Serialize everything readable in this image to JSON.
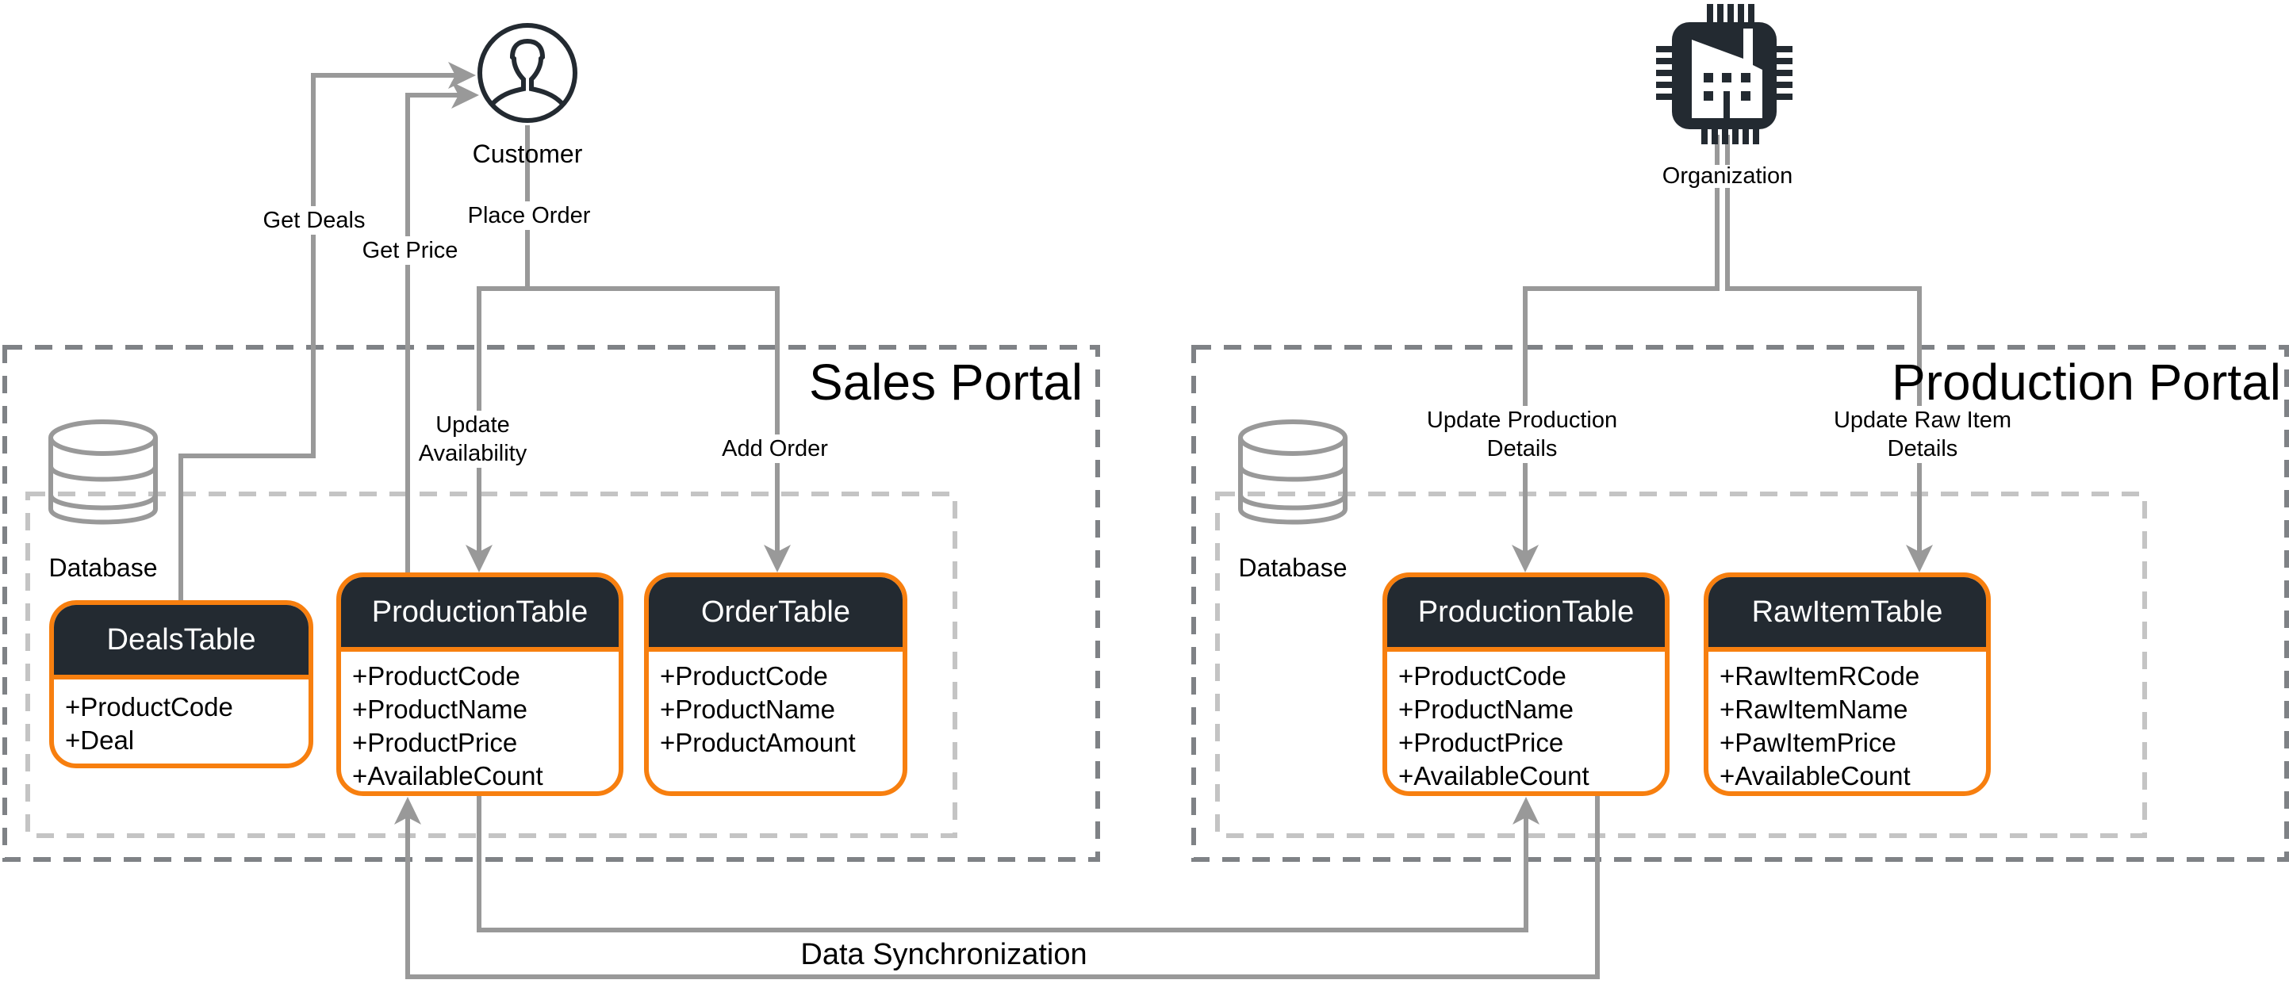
{
  "actors": {
    "customer": {
      "label": "Customer",
      "icon": "user-circle-icon"
    },
    "organization": {
      "label": "Organization",
      "icon": "factory-chip-icon"
    }
  },
  "portals": {
    "sales": {
      "title": "Sales Portal",
      "database_label": "Database",
      "tables": [
        {
          "name": "DealsTable",
          "fields": [
            "+ProductCode",
            "+Deal"
          ]
        },
        {
          "name": "ProductionTable",
          "fields": [
            "+ProductCode",
            "+ProductName",
            "+ProductPrice",
            "+AvailableCount"
          ]
        },
        {
          "name": "OrderTable",
          "fields": [
            "+ProductCode",
            "+ProductName",
            "+ProductAmount"
          ]
        }
      ]
    },
    "production": {
      "title": "Production Portal",
      "database_label": "Database",
      "tables": [
        {
          "name": "ProductionTable",
          "fields": [
            "+ProductCode",
            "+ProductName",
            "+ProductPrice",
            "+AvailableCount"
          ]
        },
        {
          "name": "RawItemTable",
          "fields": [
            "+RawItemRCode",
            "+RawItemName",
            "+PawItemPrice",
            "+AvailableCount"
          ]
        }
      ]
    }
  },
  "edges": {
    "get_deals": "Get Deals",
    "get_price": "Get Price",
    "place_order": "Place Order",
    "update_availability": "Update\nAvailability",
    "add_order": "Add Order",
    "update_production_details": "Update Production\nDetails",
    "update_raw_item_details": "Update Raw Item\nDetails",
    "data_synchronization": "Data Synchronization"
  },
  "colors": {
    "table_border": "#f77f0f",
    "table_header": "#232a31",
    "connector": "#999999",
    "outer_frame": "#7f8286",
    "inner_frame": "#c4c4c4",
    "icon_dark": "#232a31",
    "db_icon": "#999999"
  }
}
